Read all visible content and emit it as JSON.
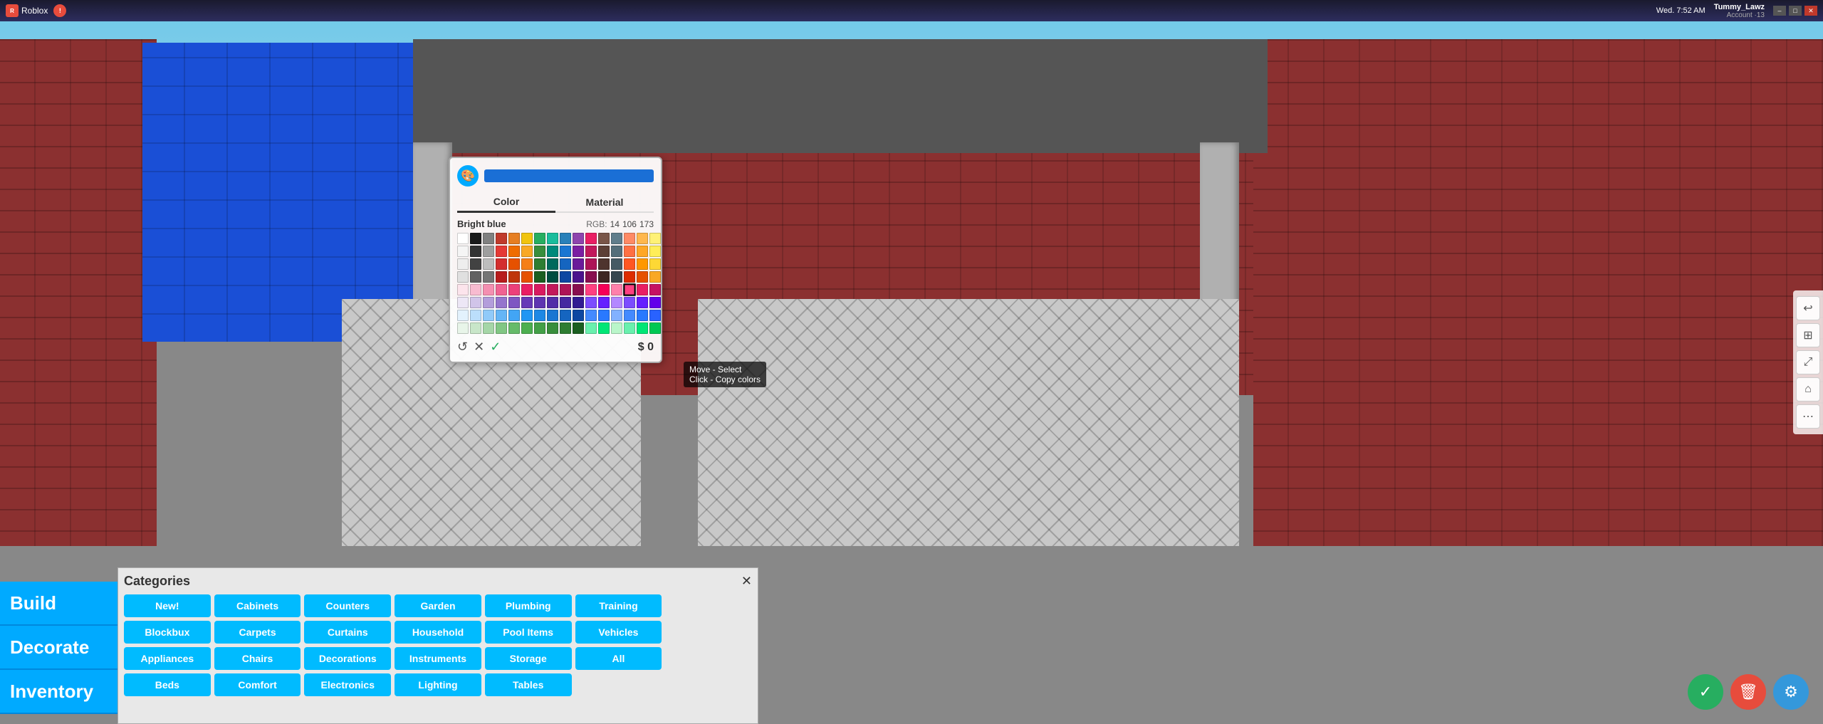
{
  "taskbar": {
    "app_title": "Roblox",
    "time": "Wed. 7:52 AM",
    "username": "Tummy_Lawz",
    "account_label": "Account ·13",
    "minimize": "–",
    "maximize": "□",
    "close": "✕"
  },
  "sidebar": {
    "build_label": "Build",
    "decorate_label": "Decorate",
    "inventory_label": "Inventory"
  },
  "categories": {
    "title": "Categories",
    "close": "✕",
    "row1": [
      "New!",
      "Cabinets",
      "Counters",
      "Garden",
      "Plumbing",
      "Training"
    ],
    "row2": [
      "Blockbux",
      "Carpets",
      "Curtains",
      "Household",
      "Pool Items",
      "Vehicles"
    ],
    "row3": [
      "Appliances",
      "Chairs",
      "Decorations",
      "Instruments",
      "Storage",
      "All"
    ],
    "row4": [
      "Beds",
      "Comfort",
      "Electronics",
      "Lighting",
      "Tables",
      ""
    ]
  },
  "color_picker": {
    "selected_color_name": "Bright blue",
    "tab_color": "Color",
    "tab_material": "Material",
    "rgb_label": "RGB:",
    "rgb_r": "14",
    "rgb_g": "106",
    "rgb_b": "173",
    "price_label": "$ 0",
    "undo_icon": "↺",
    "cancel_icon": "✕",
    "confirm_icon": "✓"
  },
  "tooltip": {
    "line1": "Move - Select",
    "line2": "Click - Copy colors"
  },
  "right_tools": {
    "undo": "↩",
    "grid": "⊞",
    "move": "⤢",
    "home": "⌂",
    "more": "⋯"
  },
  "bottom_actions": {
    "confirm": "✓",
    "delete": "🗑",
    "settings": "⚙"
  },
  "colors": [
    "#FFFFFF",
    "#1a1a1a",
    "#808080",
    "#c0392b",
    "#e67e22",
    "#f1c40f",
    "#27ae60",
    "#1abc9c",
    "#2980b9",
    "#8e44ad",
    "#e91e63",
    "#795548",
    "#607d8b",
    "#ff8a65",
    "#ffb74d",
    "#fff176",
    "#f5f5f5",
    "#333333",
    "#9e9e9e",
    "#e53935",
    "#ef6c00",
    "#f9a825",
    "#388e3c",
    "#00897b",
    "#1976d2",
    "#7b1fa2",
    "#c2185b",
    "#5d4037",
    "#546e7a",
    "#ff7043",
    "#ffa726",
    "#ffee58",
    "#eeeeee",
    "#424242",
    "#bdbdbd",
    "#d32f2f",
    "#e65100",
    "#f57f17",
    "#2e7d32",
    "#00695c",
    "#1565c0",
    "#6a1b9a",
    "#ad1457",
    "#4e342e",
    "#455a64",
    "#ff5722",
    "#ff9800",
    "#fdd835",
    "#e0e0e0",
    "#616161",
    "#757575",
    "#b71c1c",
    "#bf360c",
    "#e65100",
    "#1b5e20",
    "#004d40",
    "#0d47a1",
    "#4a148c",
    "#880e4f",
    "#3e2723",
    "#37474f",
    "#dd2c00",
    "#e65100",
    "#f9a825",
    "#fce4ec",
    "#f8bbd0",
    "#f48fb1",
    "#f06292",
    "#ec407a",
    "#e91e63",
    "#d81b60",
    "#c2185b",
    "#ad1457",
    "#880e4f",
    "#ff4081",
    "#f50057",
    "#ff80ab",
    "#ff4081",
    "#e91e63",
    "#c51162",
    "#ede7f6",
    "#d1c4e9",
    "#b39ddb",
    "#9575cd",
    "#7e57c2",
    "#673ab7",
    "#5e35b1",
    "#512da8",
    "#4527a0",
    "#311b92",
    "#7c4dff",
    "#651fff",
    "#b388ff",
    "#7c4dff",
    "#651fff",
    "#6200ea",
    "#e3f2fd",
    "#bbdefb",
    "#90caf9",
    "#64b5f6",
    "#42a5f5",
    "#2196f3",
    "#1e88e5",
    "#1976d2",
    "#1565c0",
    "#0d47a1",
    "#448aff",
    "#2979ff",
    "#82b1ff",
    "#448aff",
    "#2979ff",
    "#2962ff",
    "#e8f5e9",
    "#c8e6c9",
    "#a5d6a7",
    "#81c784",
    "#66bb6a",
    "#4caf50",
    "#43a047",
    "#388e3c",
    "#2e7d32",
    "#1b5e20",
    "#69f0ae",
    "#00e676",
    "#b9f6ca",
    "#69f0ae",
    "#00e676",
    "#00c853"
  ]
}
